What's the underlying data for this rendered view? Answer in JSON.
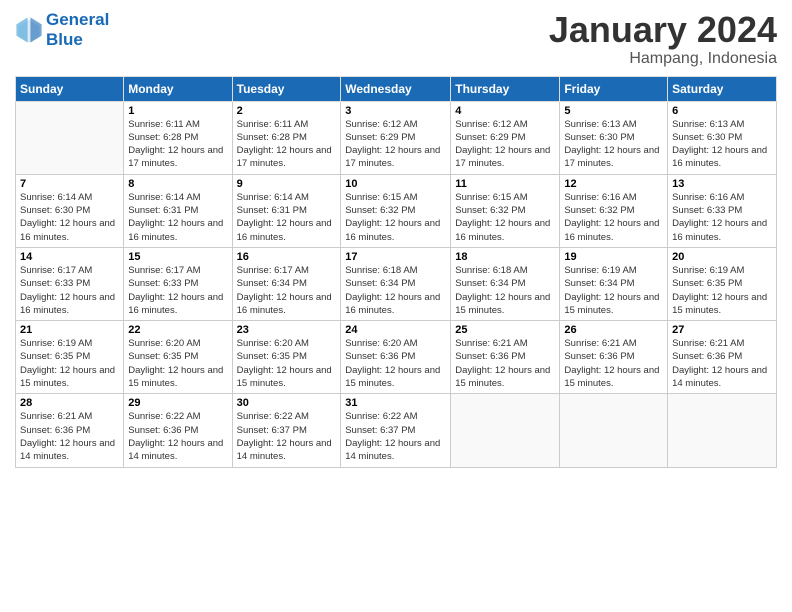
{
  "logo": {
    "line1": "General",
    "line2": "Blue"
  },
  "title": "January 2024",
  "location": "Hampang, Indonesia",
  "days_header": [
    "Sunday",
    "Monday",
    "Tuesday",
    "Wednesday",
    "Thursday",
    "Friday",
    "Saturday"
  ],
  "weeks": [
    [
      {
        "day": "",
        "sunrise": "",
        "sunset": "",
        "daylight": ""
      },
      {
        "day": "1",
        "sunrise": "Sunrise: 6:11 AM",
        "sunset": "Sunset: 6:28 PM",
        "daylight": "Daylight: 12 hours and 17 minutes."
      },
      {
        "day": "2",
        "sunrise": "Sunrise: 6:11 AM",
        "sunset": "Sunset: 6:28 PM",
        "daylight": "Daylight: 12 hours and 17 minutes."
      },
      {
        "day": "3",
        "sunrise": "Sunrise: 6:12 AM",
        "sunset": "Sunset: 6:29 PM",
        "daylight": "Daylight: 12 hours and 17 minutes."
      },
      {
        "day": "4",
        "sunrise": "Sunrise: 6:12 AM",
        "sunset": "Sunset: 6:29 PM",
        "daylight": "Daylight: 12 hours and 17 minutes."
      },
      {
        "day": "5",
        "sunrise": "Sunrise: 6:13 AM",
        "sunset": "Sunset: 6:30 PM",
        "daylight": "Daylight: 12 hours and 17 minutes."
      },
      {
        "day": "6",
        "sunrise": "Sunrise: 6:13 AM",
        "sunset": "Sunset: 6:30 PM",
        "daylight": "Daylight: 12 hours and 16 minutes."
      }
    ],
    [
      {
        "day": "7",
        "sunrise": "Sunrise: 6:14 AM",
        "sunset": "Sunset: 6:30 PM",
        "daylight": "Daylight: 12 hours and 16 minutes."
      },
      {
        "day": "8",
        "sunrise": "Sunrise: 6:14 AM",
        "sunset": "Sunset: 6:31 PM",
        "daylight": "Daylight: 12 hours and 16 minutes."
      },
      {
        "day": "9",
        "sunrise": "Sunrise: 6:14 AM",
        "sunset": "Sunset: 6:31 PM",
        "daylight": "Daylight: 12 hours and 16 minutes."
      },
      {
        "day": "10",
        "sunrise": "Sunrise: 6:15 AM",
        "sunset": "Sunset: 6:32 PM",
        "daylight": "Daylight: 12 hours and 16 minutes."
      },
      {
        "day": "11",
        "sunrise": "Sunrise: 6:15 AM",
        "sunset": "Sunset: 6:32 PM",
        "daylight": "Daylight: 12 hours and 16 minutes."
      },
      {
        "day": "12",
        "sunrise": "Sunrise: 6:16 AM",
        "sunset": "Sunset: 6:32 PM",
        "daylight": "Daylight: 12 hours and 16 minutes."
      },
      {
        "day": "13",
        "sunrise": "Sunrise: 6:16 AM",
        "sunset": "Sunset: 6:33 PM",
        "daylight": "Daylight: 12 hours and 16 minutes."
      }
    ],
    [
      {
        "day": "14",
        "sunrise": "Sunrise: 6:17 AM",
        "sunset": "Sunset: 6:33 PM",
        "daylight": "Daylight: 12 hours and 16 minutes."
      },
      {
        "day": "15",
        "sunrise": "Sunrise: 6:17 AM",
        "sunset": "Sunset: 6:33 PM",
        "daylight": "Daylight: 12 hours and 16 minutes."
      },
      {
        "day": "16",
        "sunrise": "Sunrise: 6:17 AM",
        "sunset": "Sunset: 6:34 PM",
        "daylight": "Daylight: 12 hours and 16 minutes."
      },
      {
        "day": "17",
        "sunrise": "Sunrise: 6:18 AM",
        "sunset": "Sunset: 6:34 PM",
        "daylight": "Daylight: 12 hours and 16 minutes."
      },
      {
        "day": "18",
        "sunrise": "Sunrise: 6:18 AM",
        "sunset": "Sunset: 6:34 PM",
        "daylight": "Daylight: 12 hours and 15 minutes."
      },
      {
        "day": "19",
        "sunrise": "Sunrise: 6:19 AM",
        "sunset": "Sunset: 6:34 PM",
        "daylight": "Daylight: 12 hours and 15 minutes."
      },
      {
        "day": "20",
        "sunrise": "Sunrise: 6:19 AM",
        "sunset": "Sunset: 6:35 PM",
        "daylight": "Daylight: 12 hours and 15 minutes."
      }
    ],
    [
      {
        "day": "21",
        "sunrise": "Sunrise: 6:19 AM",
        "sunset": "Sunset: 6:35 PM",
        "daylight": "Daylight: 12 hours and 15 minutes."
      },
      {
        "day": "22",
        "sunrise": "Sunrise: 6:20 AM",
        "sunset": "Sunset: 6:35 PM",
        "daylight": "Daylight: 12 hours and 15 minutes."
      },
      {
        "day": "23",
        "sunrise": "Sunrise: 6:20 AM",
        "sunset": "Sunset: 6:35 PM",
        "daylight": "Daylight: 12 hours and 15 minutes."
      },
      {
        "day": "24",
        "sunrise": "Sunrise: 6:20 AM",
        "sunset": "Sunset: 6:36 PM",
        "daylight": "Daylight: 12 hours and 15 minutes."
      },
      {
        "day": "25",
        "sunrise": "Sunrise: 6:21 AM",
        "sunset": "Sunset: 6:36 PM",
        "daylight": "Daylight: 12 hours and 15 minutes."
      },
      {
        "day": "26",
        "sunrise": "Sunrise: 6:21 AM",
        "sunset": "Sunset: 6:36 PM",
        "daylight": "Daylight: 12 hours and 15 minutes."
      },
      {
        "day": "27",
        "sunrise": "Sunrise: 6:21 AM",
        "sunset": "Sunset: 6:36 PM",
        "daylight": "Daylight: 12 hours and 14 minutes."
      }
    ],
    [
      {
        "day": "28",
        "sunrise": "Sunrise: 6:21 AM",
        "sunset": "Sunset: 6:36 PM",
        "daylight": "Daylight: 12 hours and 14 minutes."
      },
      {
        "day": "29",
        "sunrise": "Sunrise: 6:22 AM",
        "sunset": "Sunset: 6:36 PM",
        "daylight": "Daylight: 12 hours and 14 minutes."
      },
      {
        "day": "30",
        "sunrise": "Sunrise: 6:22 AM",
        "sunset": "Sunset: 6:37 PM",
        "daylight": "Daylight: 12 hours and 14 minutes."
      },
      {
        "day": "31",
        "sunrise": "Sunrise: 6:22 AM",
        "sunset": "Sunset: 6:37 PM",
        "daylight": "Daylight: 12 hours and 14 minutes."
      },
      {
        "day": "",
        "sunrise": "",
        "sunset": "",
        "daylight": ""
      },
      {
        "day": "",
        "sunrise": "",
        "sunset": "",
        "daylight": ""
      },
      {
        "day": "",
        "sunrise": "",
        "sunset": "",
        "daylight": ""
      }
    ]
  ]
}
